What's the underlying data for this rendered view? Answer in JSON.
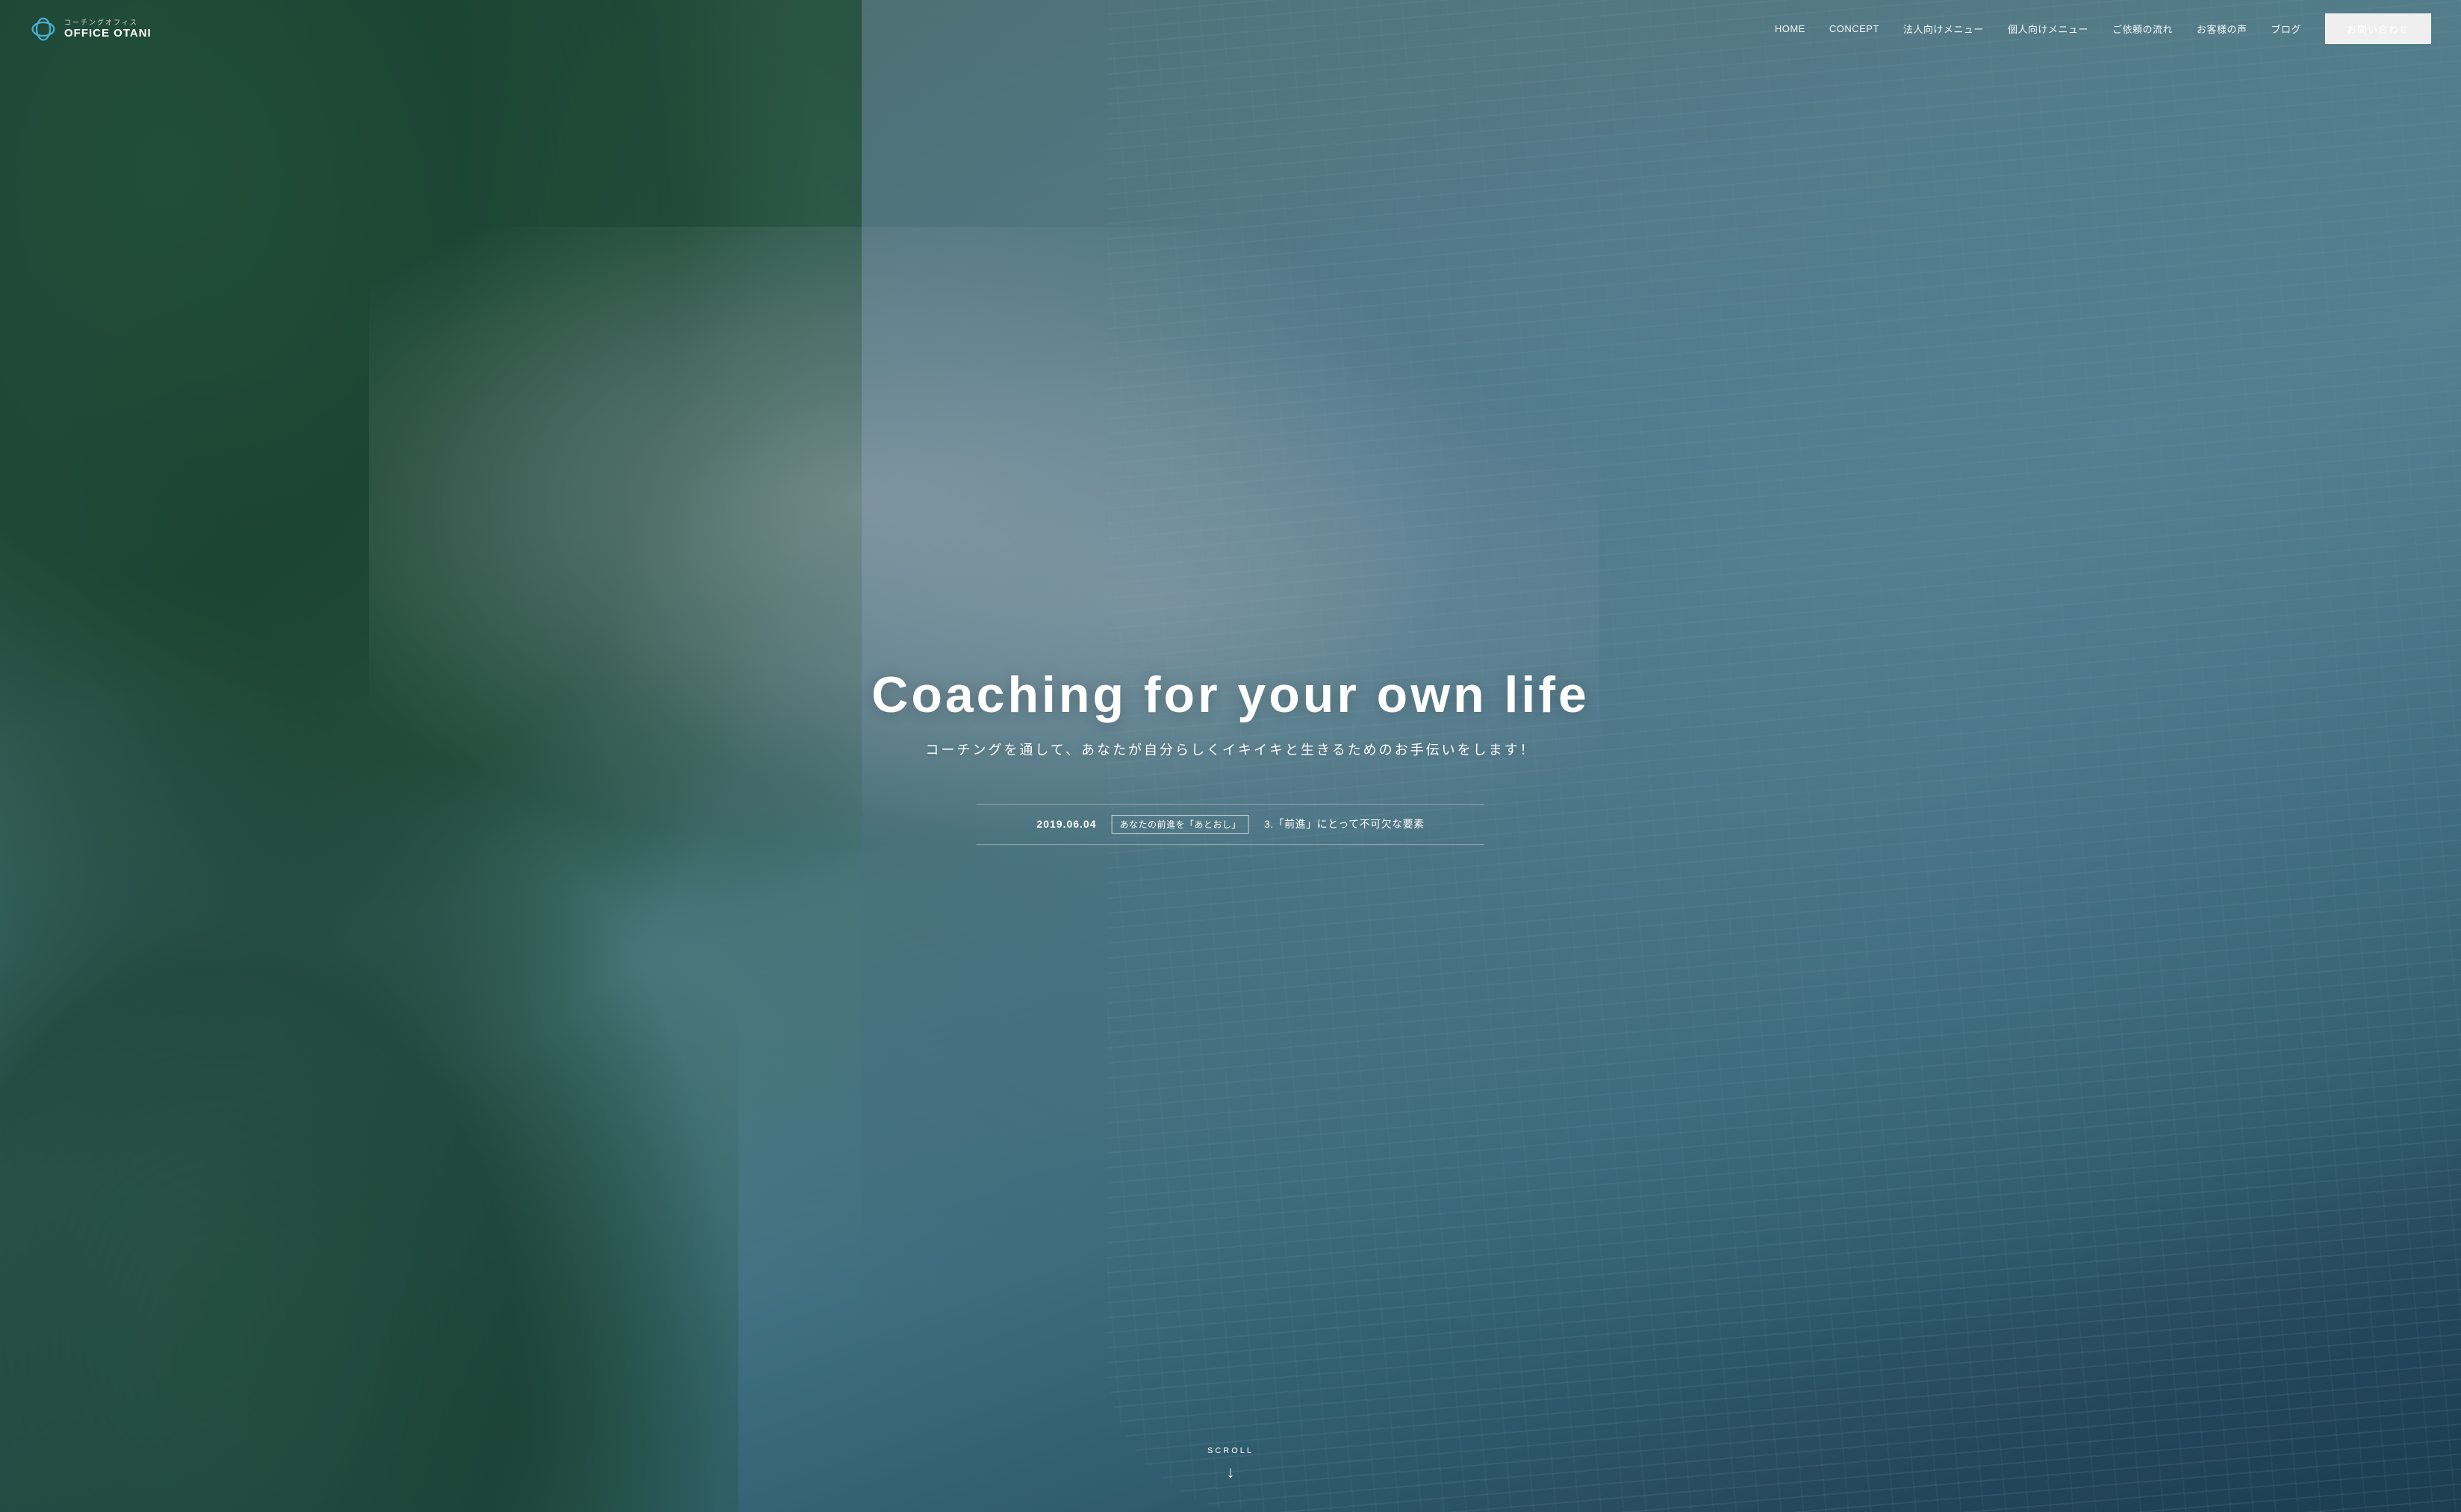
{
  "site": {
    "logo_subtext": "コーチングオフィス",
    "logo_name": "OFFICE OTANI"
  },
  "nav": {
    "items": [
      {
        "label": "HOME",
        "id": "home"
      },
      {
        "label": "CONCEPT",
        "id": "concept"
      },
      {
        "label": "法人向けメニュー",
        "id": "corporate-menu"
      },
      {
        "label": "個人向けメニュー",
        "id": "personal-menu"
      },
      {
        "label": "ご依頼の流れ",
        "id": "flow"
      },
      {
        "label": "お客様の声",
        "id": "testimonials"
      },
      {
        "label": "ブログ",
        "id": "blog"
      }
    ],
    "contact_label": "お問い合わせ"
  },
  "hero": {
    "title": "Coaching for  your  own  life",
    "subtitle": "コーチングを通して、あなたが自分らしくイキイキと生きるためのお手伝いをします！"
  },
  "news": {
    "date": "2019.06.04",
    "tag": "あなたの前進を「あとおし」",
    "title": "3.「前進」にとって不可欠な要素"
  },
  "scroll": {
    "label": "SCROLL",
    "arrow": "↓"
  }
}
